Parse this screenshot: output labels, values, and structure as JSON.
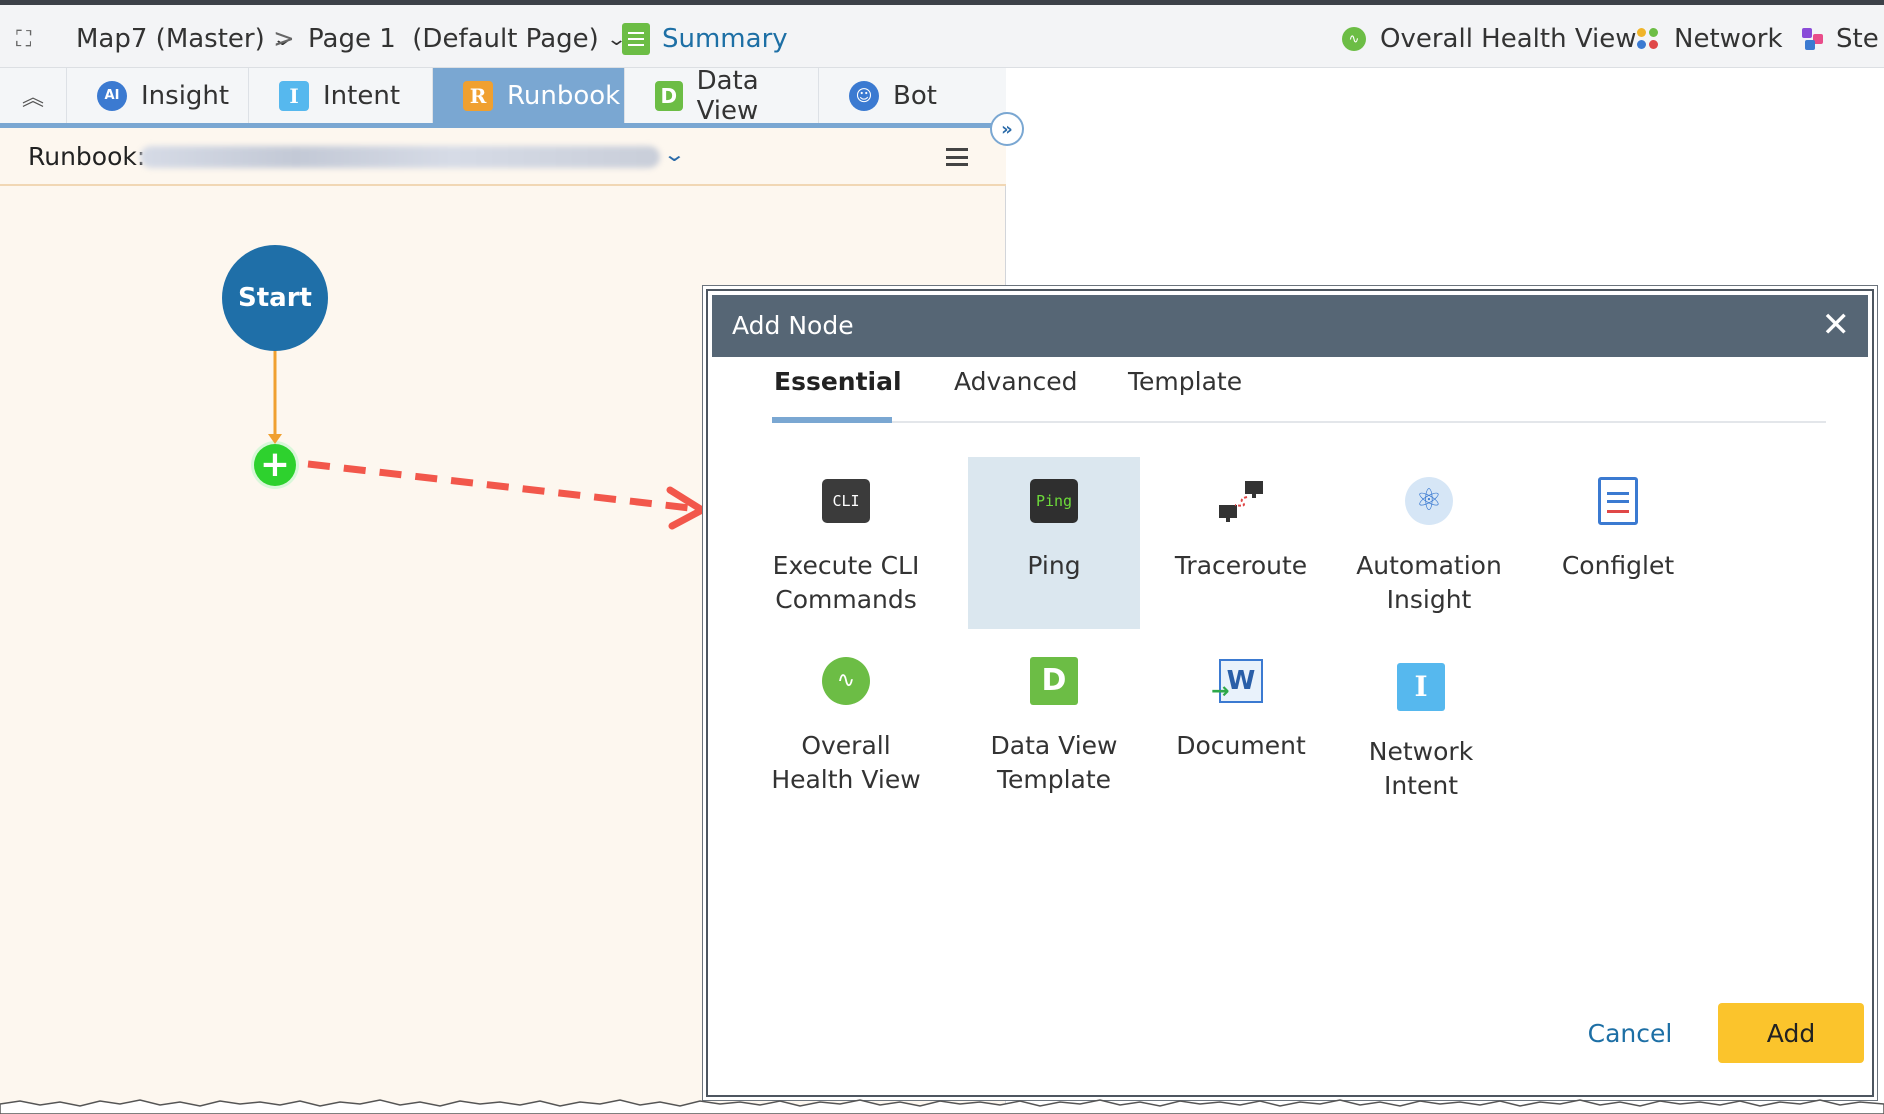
{
  "header": {
    "map_title": "Map7 (Master)",
    "separator": ">",
    "page_title": "Page 1  (Default Page)",
    "summary_label": "Summary",
    "right_items": [
      "Overall Health View",
      "Network",
      "Ste"
    ]
  },
  "tabs": [
    {
      "label": "Insight",
      "icon": "ai-robot-icon",
      "active": false
    },
    {
      "label": "Intent",
      "icon": "intent-icon",
      "active": false
    },
    {
      "label": "Runbook",
      "icon": "runbook-icon",
      "active": true
    },
    {
      "label": "Data View",
      "icon": "data-view-icon",
      "active": false
    },
    {
      "label": "Bot",
      "icon": "bot-icon",
      "active": false
    }
  ],
  "runbook": {
    "label": "Runbook:"
  },
  "canvas": {
    "start_label": "Start",
    "plus_symbol": "+"
  },
  "dialog": {
    "title": "Add Node",
    "close_symbol": "✕",
    "tabs": [
      "Essential",
      "Advanced",
      "Template"
    ],
    "active_tab": "Essential",
    "nodes": [
      {
        "label": "Execute CLI Commands",
        "icon": "cli-icon",
        "icon_text": "CLI",
        "selected": false
      },
      {
        "label": "Ping",
        "icon": "ping-icon",
        "icon_text": "Ping",
        "selected": true
      },
      {
        "label": "Traceroute",
        "icon": "traceroute-icon",
        "selected": false
      },
      {
        "label": "Automation Insight",
        "icon": "atom-icon",
        "selected": false
      },
      {
        "label": "Configlet",
        "icon": "document-icon",
        "selected": false
      },
      {
        "label": "Overall Health View",
        "icon": "health-icon",
        "selected": false
      },
      {
        "label": "Data View Template",
        "icon": "data-view-icon",
        "icon_text": "D",
        "selected": false
      },
      {
        "label": "Document",
        "icon": "word-icon",
        "icon_text": "W",
        "selected": false
      },
      {
        "label": "Network Intent",
        "icon": "intent-icon",
        "icon_text": "I",
        "selected": false
      }
    ],
    "cancel_label": "Cancel",
    "add_label": "Add"
  },
  "colors": {
    "accent_blue": "#1f6fa8",
    "tab_active": "#7aa7d2",
    "add_button": "#fbc42c",
    "dialog_header": "#566675",
    "green": "#6cbd45",
    "arrow_red": "#f2574b"
  }
}
